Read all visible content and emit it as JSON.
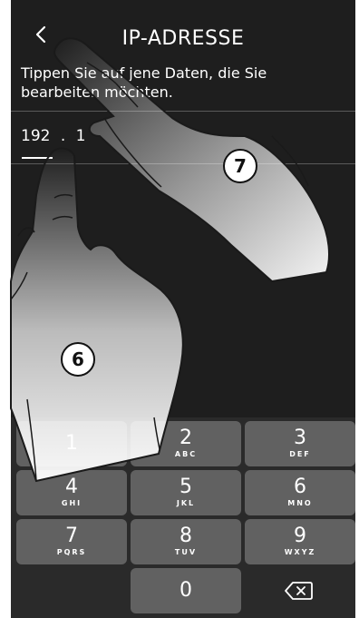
{
  "header": {
    "title": "IP-ADRESSE",
    "back_icon": "chevron-left-icon"
  },
  "description": "Tippen Sie auf jene Daten, die Sie bearbeiten möchten.",
  "ip_field": {
    "part1": "192",
    "dot": ".",
    "part2": "1"
  },
  "keypad": {
    "keys": [
      {
        "num": "1",
        "letters": ""
      },
      {
        "num": "2",
        "letters": "ABC"
      },
      {
        "num": "3",
        "letters": "DEF"
      },
      {
        "num": "4",
        "letters": "GHI"
      },
      {
        "num": "5",
        "letters": "JKL"
      },
      {
        "num": "6",
        "letters": "MNO"
      },
      {
        "num": "7",
        "letters": "PQRS"
      },
      {
        "num": "8",
        "letters": "TUV"
      },
      {
        "num": "9",
        "letters": "WXYZ"
      },
      {
        "num": "0",
        "letters": ""
      }
    ],
    "delete_icon": "backspace-icon"
  },
  "callouts": {
    "left": "6",
    "right": "7"
  },
  "colors": {
    "screen_bg": "#1e1e1e",
    "key_bg": "#616161",
    "text": "#ffffff"
  }
}
